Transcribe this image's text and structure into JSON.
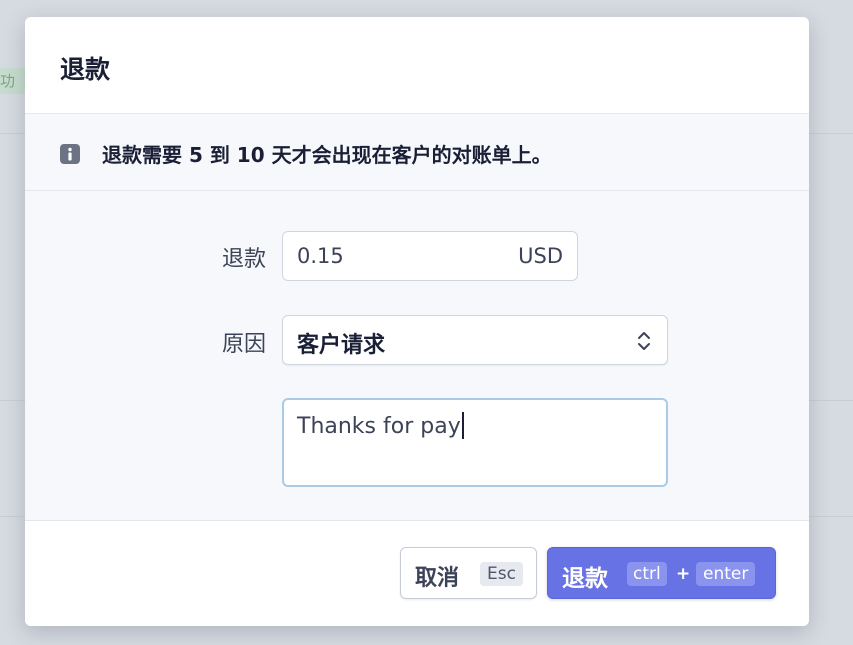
{
  "background": {
    "partial_badge_text": "功"
  },
  "modal": {
    "title": "退款",
    "notice_text": "退款需要 5 到 10 天才会出现在客户的对账单上。",
    "info_icon": "info-icon",
    "form": {
      "amount_label": "退款",
      "amount_value": "0.15",
      "amount_currency": "USD",
      "reason_label": "原因",
      "reason_selected": "客户请求",
      "note_value": "Thanks for pay"
    },
    "footer": {
      "cancel_label": "取消",
      "cancel_shortcut": "Esc",
      "refund_label": "退款",
      "refund_shortcut_mod": "ctrl",
      "refund_shortcut_plus": "+",
      "refund_shortcut_key": "enter"
    }
  },
  "colors": {
    "primary_button": "#6772e5",
    "textarea_focus_border": "#a9cbe6",
    "panel_background": "#f6f8fb",
    "overlay_background": "#d6dae1"
  }
}
